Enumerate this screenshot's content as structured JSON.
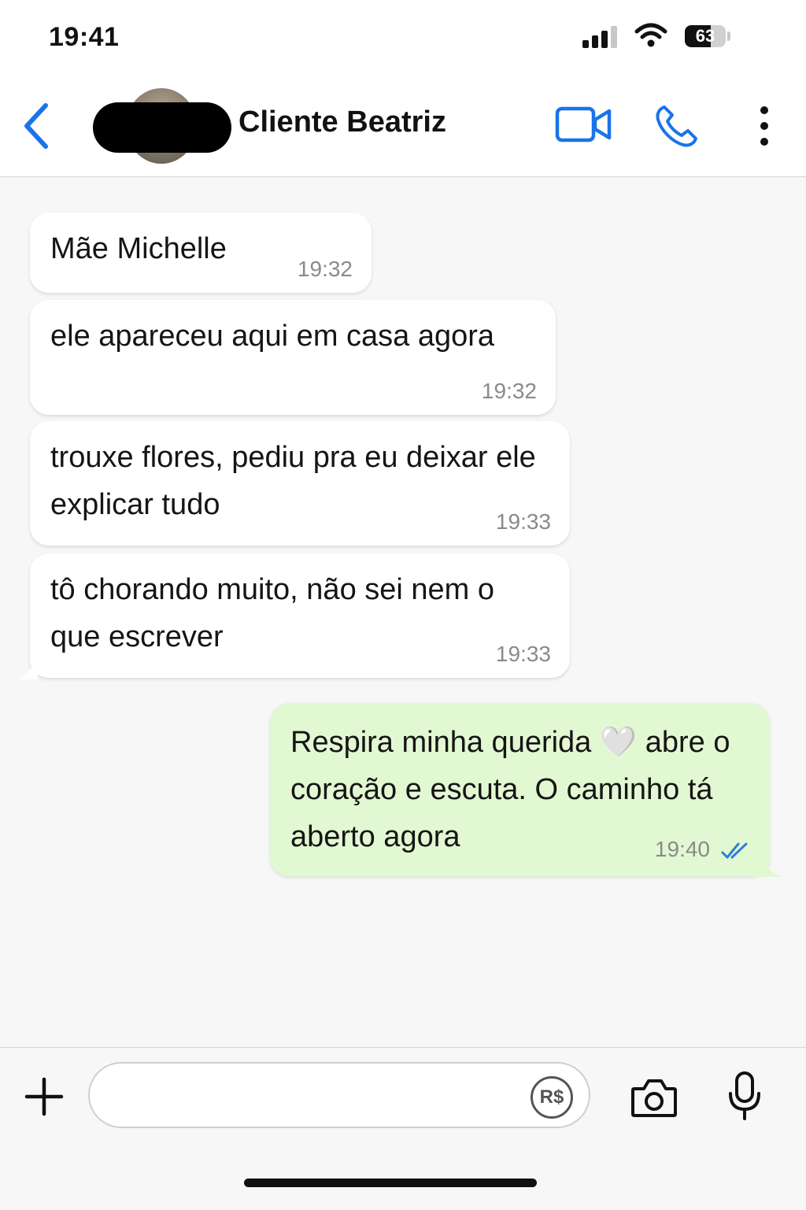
{
  "status_bar": {
    "time": "19:41",
    "battery_level": "63",
    "battery_fraction": 0.63
  },
  "header": {
    "contact_name": "Cliente Beatriz",
    "accent_color": "#1a73e8"
  },
  "messages": [
    {
      "direction": "in",
      "text": "Mãe Michelle",
      "time": "19:32"
    },
    {
      "direction": "in",
      "text": "ele apareceu aqui em casa agora",
      "time": "19:32"
    },
    {
      "direction": "in",
      "text": "trouxe flores, pediu pra eu deixar ele explicar tudo",
      "time": "19:33"
    },
    {
      "direction": "in",
      "text": "tô chorando muito, não sei nem o que escrever",
      "time": "19:33"
    },
    {
      "direction": "out",
      "text": "Respira minha querida 🤍 abre o coração e escuta. O caminho tá aberto agora",
      "time": "19:40",
      "status": "read"
    }
  ],
  "input_bar": {
    "placeholder": "",
    "value": "",
    "pay_label": "R$"
  },
  "colors": {
    "incoming_bubble": "#ffffff",
    "outgoing_bubble": "#e2f8d2",
    "read_ticks": "#2f7fd6"
  }
}
